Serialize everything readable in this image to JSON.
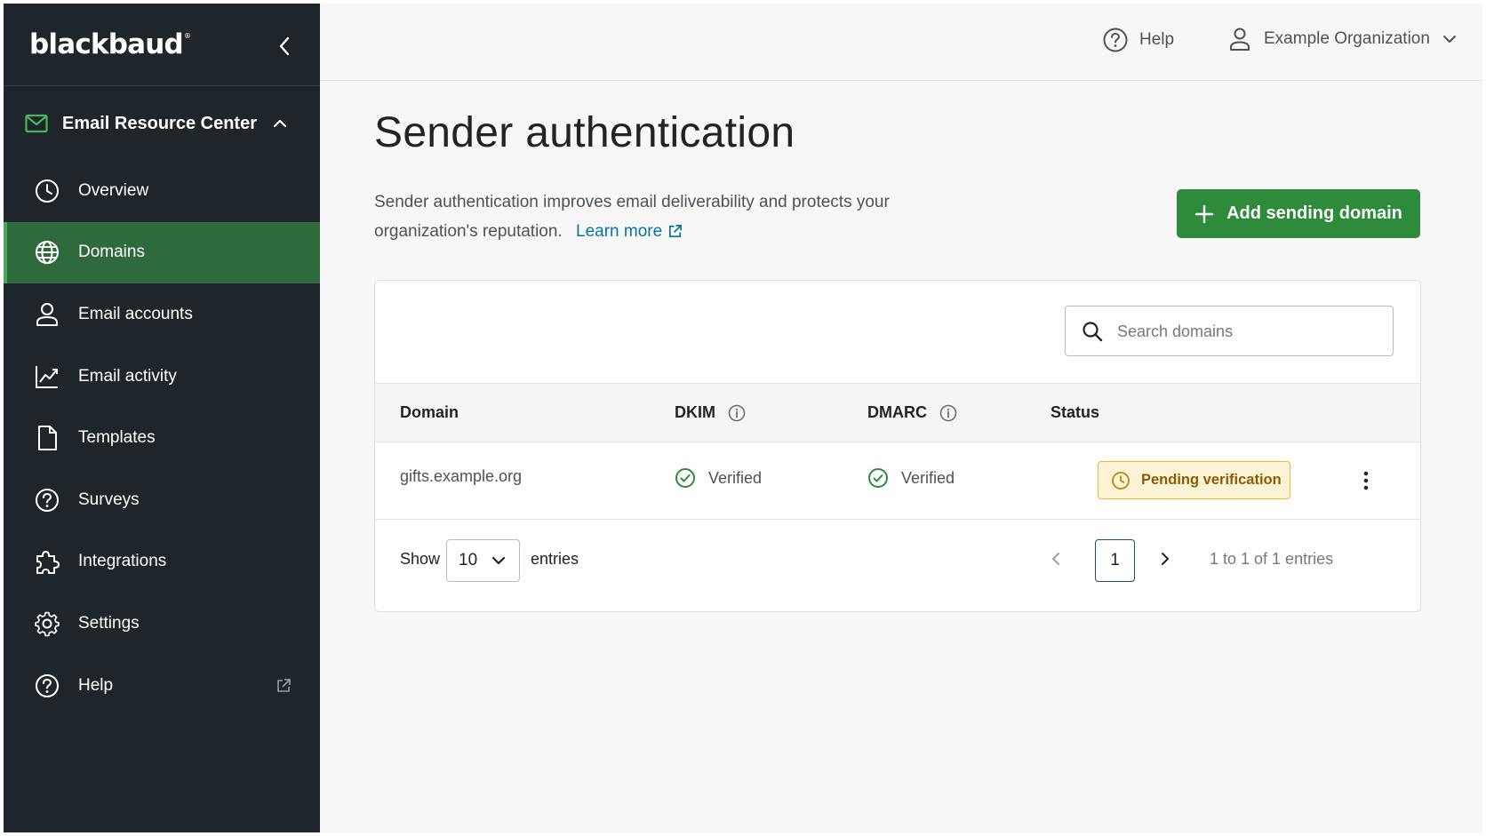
{
  "sidebar": {
    "logo": "blackbaud",
    "logo_mark": "®",
    "section": {
      "label": "Email Resource Center",
      "icon": "mail-icon"
    },
    "items": [
      {
        "label": "Overview",
        "icon": "clock-icon"
      },
      {
        "label": "Domains",
        "icon": "globe-icon",
        "active": true
      },
      {
        "label": "Email accounts",
        "icon": "person-icon"
      },
      {
        "label": "Email activity",
        "icon": "chart-icon"
      },
      {
        "label": "Templates",
        "icon": "document-icon"
      },
      {
        "label": "Surveys",
        "icon": "question-circle-icon"
      },
      {
        "label": "Integrations",
        "icon": "puzzle-icon"
      },
      {
        "label": "Settings",
        "icon": "gear-icon"
      },
      {
        "label": "Help",
        "icon": "help-circle-icon",
        "external": true
      }
    ]
  },
  "topbar": {
    "help_label": "Help",
    "org_label": "Example Organization"
  },
  "page": {
    "title": "Sender authentication",
    "description": "Sender authentication improves email deliverability and protects your organization's reputation.",
    "learn_more": "Learn more",
    "add_button": "Add sending domain"
  },
  "search": {
    "placeholder": "Search domains",
    "value": ""
  },
  "table": {
    "columns": [
      "Domain",
      "DKIM",
      "DMARC",
      "Status"
    ],
    "rows": [
      {
        "domain": "gifts.example.org",
        "dkim": "Verified",
        "dmarc": "Verified",
        "status": "Pending verification"
      }
    ]
  },
  "pagination": {
    "show_label": "Show",
    "page_size": "10",
    "entries_label": "entries",
    "current_page": "1",
    "range_text": "1 to 1 of 1 entries"
  },
  "colors": {
    "sidebar_bg": "#1f262b",
    "active_nav": "#2f6a3c",
    "primary_button": "#2e8b3b",
    "link": "#0974a1",
    "warning_bg": "#fcf2d6",
    "warning_border": "#e8b935",
    "success": "#2e8b3b"
  }
}
